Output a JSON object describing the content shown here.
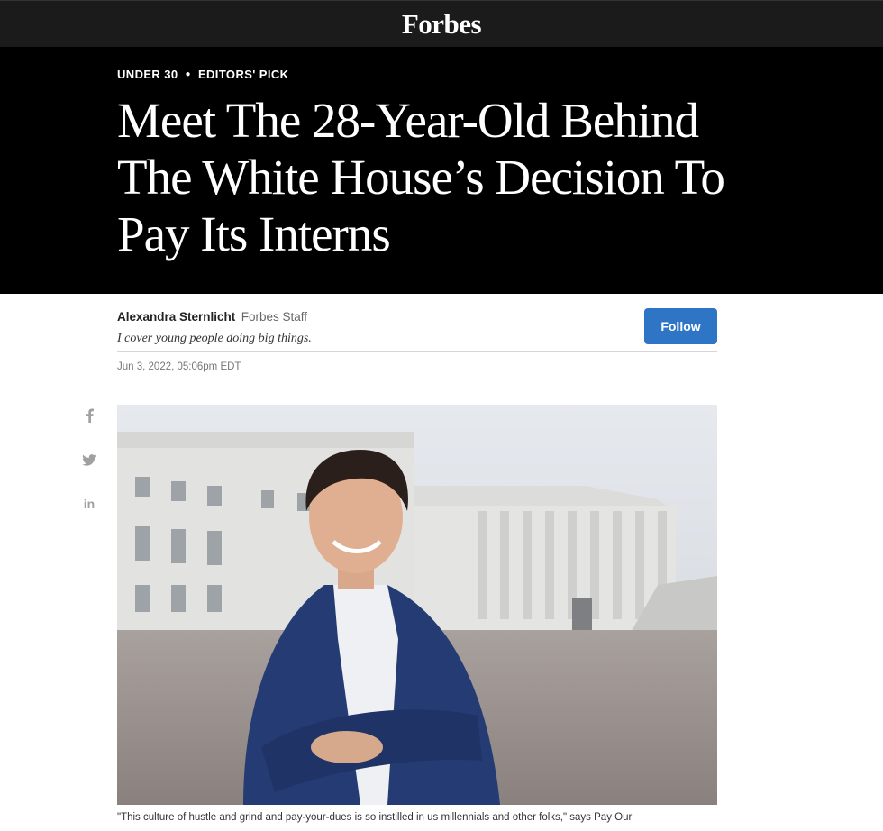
{
  "header": {
    "logo": "Forbes"
  },
  "article": {
    "kicker": [
      "UNDER 30",
      "EDITORS' PICK"
    ],
    "title": "Meet The 28-Year-Old Behind The White House’s Decision To Pay Its Interns",
    "author": {
      "name": "Alexandra Sternlicht",
      "type": "Forbes Staff",
      "bio": "I cover young people doing big things.",
      "follow_label": "Follow"
    },
    "date": "Jun 3, 2022, 05:06pm EDT",
    "caption": "\"This culture of hustle and grind and pay-your-dues is so instilled in us millennials and other folks,\" says Pay Our"
  },
  "share": {
    "facebook": "f",
    "linkedin": "in"
  },
  "colors": {
    "follow": "#2e76c5",
    "hero_bg": "#000000",
    "topbar_bg": "#1b1b1b"
  }
}
